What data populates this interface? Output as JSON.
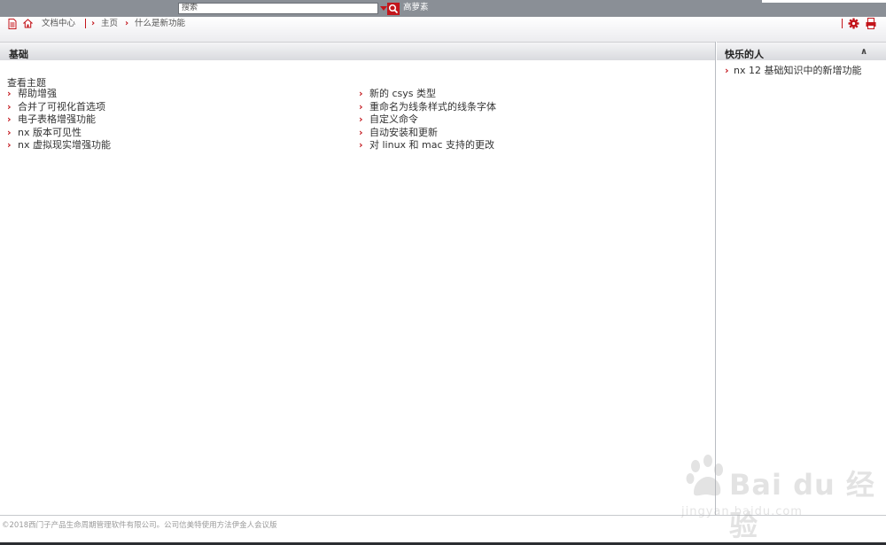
{
  "topbar": {
    "search_placeholder": "搜索",
    "advanced_label": "高萝素"
  },
  "breadcrumb": {
    "doc_center": "文档中心",
    "home": "主页",
    "current": "什么是新功能"
  },
  "main": {
    "title": "基础",
    "see_topics": "查看主题",
    "left_links": [
      "帮助增强",
      "合并了可视化首选项",
      "电子表格增强功能",
      "nx 版本可见性",
      "nx 虚拟现实增强功能"
    ],
    "right_links": [
      "新的 csys 类型",
      "重命名为线条样式的线条字体",
      "自定义命令",
      "自动安装和更新",
      "对 linux 和 mac 支持的更改"
    ]
  },
  "sidebar": {
    "title": "快乐的人",
    "collapse_glyph": "∧",
    "links": [
      "nx 12 基础知识中的新增功能"
    ]
  },
  "footer": {
    "text": "©2018西门子产品生命周期管理软件有限公司。公司信美特使用方法伊金人会议版"
  },
  "watermark": {
    "brand": "Bai du 经验",
    "url": "jingyan.baidu.com"
  },
  "colors": {
    "accent": "#c3161c",
    "topbar": "#8a8f96"
  }
}
